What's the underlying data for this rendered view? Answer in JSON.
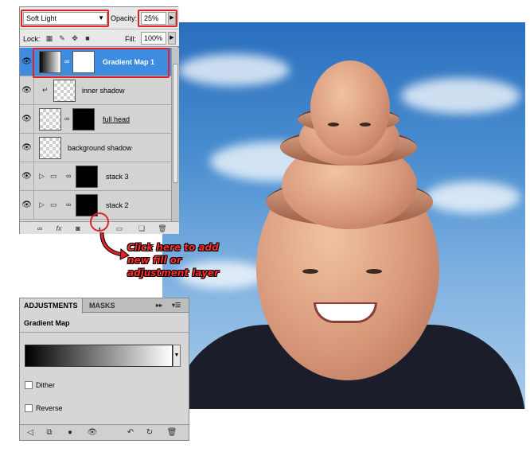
{
  "layers_panel": {
    "blend_mode": "Soft Light",
    "opacity_label": "Opacity:",
    "opacity_value": "25%",
    "lock_label": "Lock:",
    "fill_label": "Fill:",
    "fill_value": "100%",
    "layers": [
      {
        "name": "Gradient Map 1",
        "selected": true
      },
      {
        "name": "inner shadow",
        "selected": false
      },
      {
        "name": "full head",
        "selected": false
      },
      {
        "name": "background shadow",
        "selected": false
      },
      {
        "name": "stack 3",
        "selected": false
      },
      {
        "name": "stack 2",
        "selected": false
      }
    ],
    "bottom_icons": [
      "link-icon",
      "fx-icon",
      "mask-icon",
      "adjustment-layer-icon",
      "folder-icon",
      "new-layer-icon",
      "trash-icon"
    ]
  },
  "callout": {
    "text_line1": "Click here to add",
    "text_line2": "new fill or",
    "text_line3": "adjustment layer",
    "color": "#ff2a2a"
  },
  "adjustments_panel": {
    "tab_adjustments": "ADJUSTMENTS",
    "tab_masks": "MASKS",
    "title": "Gradient Map",
    "dither_label": "Dither",
    "reverse_label": "Reverse",
    "dither_checked": false,
    "reverse_checked": false
  },
  "colors": {
    "highlight": "#e0212a",
    "selected_layer": "#3d8ce0",
    "sky": "#4a8ed0"
  }
}
